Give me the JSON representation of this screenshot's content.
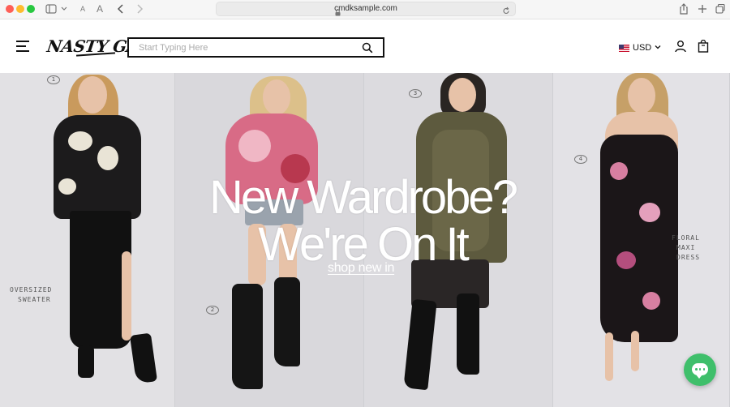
{
  "browser": {
    "url": "cmdksample.com",
    "text_size_small": "A",
    "text_size_large": "A"
  },
  "header": {
    "logo": "NASTY GAL",
    "search": {
      "placeholder": "Start Typing Here",
      "value": ""
    },
    "currency": "USD"
  },
  "hero": {
    "headline_line1": "New Wardrobe?",
    "headline_line2": "We're On It",
    "cta": "shop new in",
    "panel_numbers": [
      "1",
      "2",
      "3",
      "4"
    ],
    "notes": {
      "left_line1": "Oversized",
      "left_line2": "Sweater",
      "right_line1": "Floral",
      "right_line2": "Maxi",
      "right_line3": "Dress"
    }
  },
  "colors": {
    "chat_button": "#3fbf6b",
    "hero_text": "#ffffff"
  }
}
